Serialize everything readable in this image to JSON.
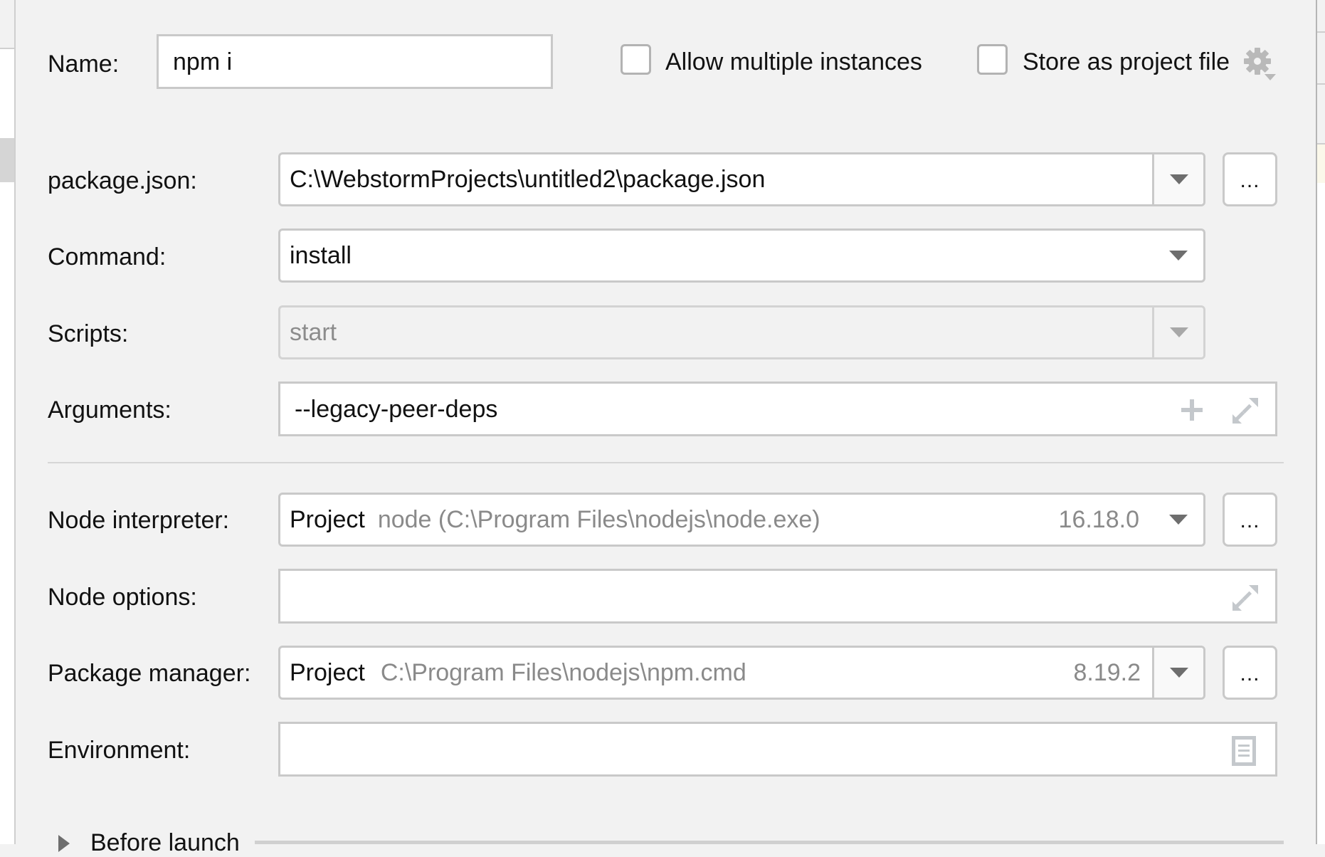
{
  "form": {
    "name_label": "Name:",
    "name_value": "npm i",
    "allow_multiple_label": "Allow multiple instances",
    "allow_multiple_checked": false,
    "store_project_label": "Store as project file",
    "store_project_checked": false,
    "package_json_label": "package.json:",
    "package_json_value": "C:\\WebstormProjects\\untitled2\\package.json",
    "command_label": "Command:",
    "command_value": "install",
    "scripts_label": "Scripts:",
    "scripts_value": "start",
    "arguments_label": "Arguments:",
    "arguments_value": "--legacy-peer-deps",
    "node_interpreter_label": "Node interpreter:",
    "node_interpreter_scope": "Project",
    "node_interpreter_path": "node (C:\\Program Files\\nodejs\\node.exe)",
    "node_interpreter_version": "16.18.0",
    "node_options_label": "Node options:",
    "node_options_value": "",
    "package_manager_label": "Package manager:",
    "package_manager_scope": "Project",
    "package_manager_path": "C:\\Program Files\\nodejs\\npm.cmd",
    "package_manager_version": "8.19.2",
    "environment_label": "Environment:",
    "environment_value": "",
    "browse_label": "...",
    "before_launch_label": "Before launch"
  },
  "icons": {
    "gear": "gear-icon",
    "dropdown": "chevron-down-icon",
    "add": "plus-icon",
    "expand": "expand-icon",
    "document": "document-icon",
    "expander": "triangle-right-icon"
  }
}
